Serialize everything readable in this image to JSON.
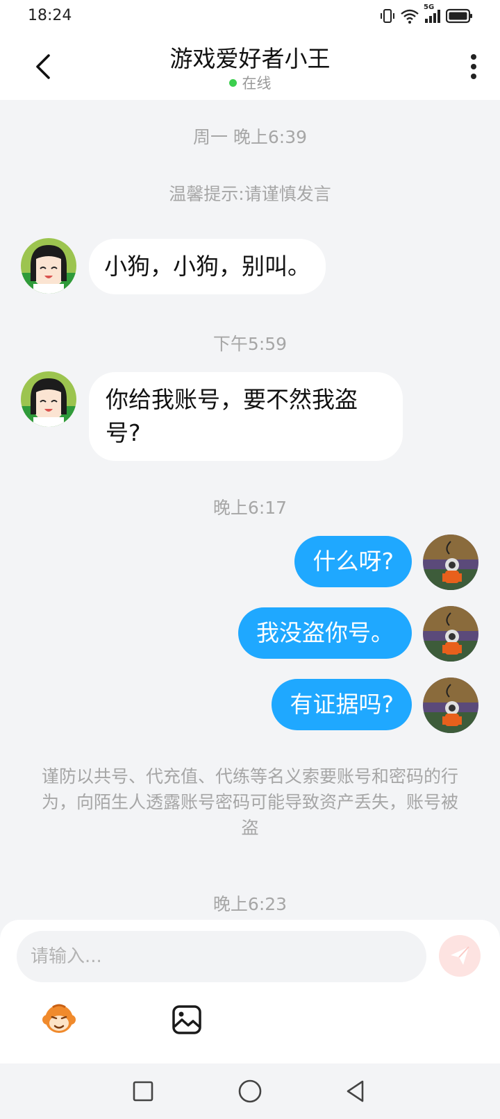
{
  "status_bar": {
    "time": "18:24",
    "network": "5G",
    "icons": [
      "vibrate-icon",
      "wifi-icon",
      "signal-icon",
      "battery-icon"
    ]
  },
  "header": {
    "title": "游戏爱好者小王",
    "status": "在线",
    "status_color": "#3ccf4e"
  },
  "chat": {
    "timestamps": [
      "周一 晚上6:39",
      "下午5:59",
      "晚上6:17",
      "晚上6:23"
    ],
    "tip": "温馨提示:请谨慎发言",
    "incoming": [
      {
        "text": "小狗，小狗，别叫。"
      },
      {
        "text_line1": "你给我账号，要不然我盗",
        "text_line2": "号?"
      }
    ],
    "outgoing": [
      {
        "text": "什么呀?"
      },
      {
        "text": "我没盗你号。"
      },
      {
        "text": "有证据吗?"
      }
    ],
    "warning": "谨防以共号、代充值、代练等名义索要账号和密码的行为，向陌生人透露账号密码可能导致资产丢失，账号被盗"
  },
  "composer": {
    "placeholder": "请输入...",
    "send_icon": "send-icon",
    "emoji_icon": "monkey-emoji-icon",
    "image_icon": "image-icon"
  },
  "colors": {
    "outgoing_bubble": "#1fa8ff",
    "incoming_bubble": "#ffffff",
    "background": "#f3f4f6"
  },
  "nav": [
    "recent-apps-icon",
    "home-icon",
    "back-icon"
  ]
}
